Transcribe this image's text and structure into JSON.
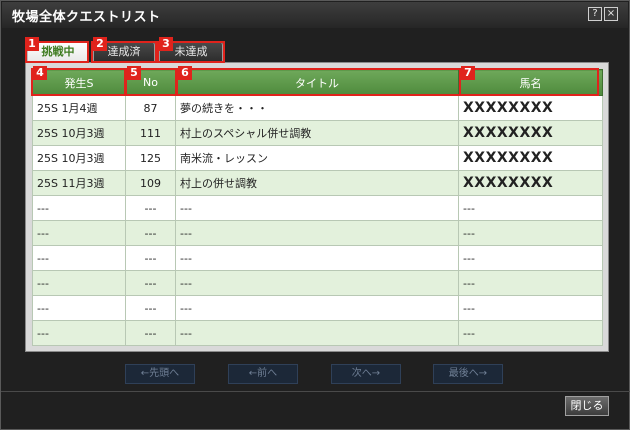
{
  "window": {
    "title": "牧場全体クエストリスト",
    "help_label": "?",
    "close_label": "×"
  },
  "tabs": [
    {
      "label": "挑戦中",
      "active": true
    },
    {
      "label": "達成済",
      "active": false
    },
    {
      "label": "未達成",
      "active": false
    }
  ],
  "callouts": [
    "1",
    "2",
    "3",
    "4",
    "5",
    "6",
    "7"
  ],
  "table": {
    "columns": [
      "発生S",
      "No",
      "タイトル",
      "馬名"
    ],
    "rows": [
      [
        "25S 1月4週",
        "87",
        "夢の続きを・・・",
        "XXXXXXXX"
      ],
      [
        "25S 10月3週",
        "111",
        "村上のスペシャル併せ調教",
        "XXXXXXXX"
      ],
      [
        "25S 10月3週",
        "125",
        "南米流・レッスン",
        "XXXXXXXX"
      ],
      [
        "25S 11月3週",
        "109",
        "村上の併せ調教",
        "XXXXXXXX"
      ],
      [
        "---",
        "---",
        "---",
        "---"
      ],
      [
        "---",
        "---",
        "---",
        "---"
      ],
      [
        "---",
        "---",
        "---",
        "---"
      ],
      [
        "---",
        "---",
        "---",
        "---"
      ],
      [
        "---",
        "---",
        "---",
        "---"
      ],
      [
        "---",
        "---",
        "---",
        "---"
      ]
    ]
  },
  "pager": {
    "first": "←先頭へ",
    "prev": "←前へ",
    "next": "次へ→",
    "last": "最後へ→"
  },
  "footer": {
    "close_button": "閉じる"
  },
  "colors": {
    "accent_green": "#4e8a3c",
    "callout_red": "#e0231c",
    "active_tab_text": "#3d7a1e"
  }
}
